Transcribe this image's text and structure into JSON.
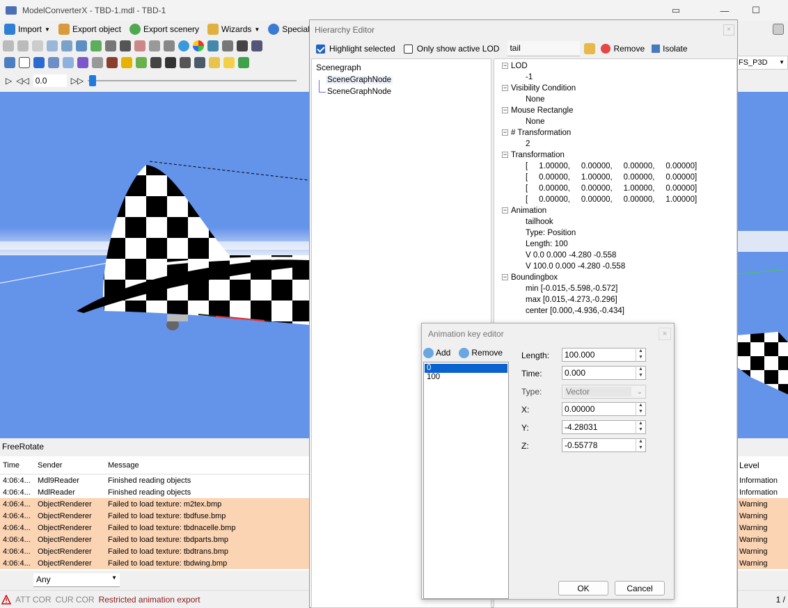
{
  "window": {
    "title": "ModelConverterX - TBD-1.mdl - TBD-1"
  },
  "toolbar1": {
    "import": "Import",
    "export_object": "Export object",
    "export_scenery": "Export scenery",
    "wizards": "Wizards",
    "special_tools": "Special too"
  },
  "animation_bar": {
    "time_value": "0.0"
  },
  "right_edge": {
    "sim_label": "FS_P3D"
  },
  "status_label": "FreeRotate",
  "log": {
    "headers": {
      "time": "Time",
      "sender": "Sender",
      "message": "Message",
      "level": "Level"
    },
    "rows": [
      {
        "time": "4:06:4...",
        "sender": "Mdl9Reader",
        "message": "Finished reading objects",
        "level": "Information",
        "warn": false
      },
      {
        "time": "4:06:4...",
        "sender": "MdlReader",
        "message": "Finished reading objects",
        "level": "Information",
        "warn": false
      },
      {
        "time": "4:06:4...",
        "sender": "ObjectRenderer",
        "message": "Failed to load texture: m2tex.bmp",
        "level": "Warning",
        "warn": true
      },
      {
        "time": "4:06:4...",
        "sender": "ObjectRenderer",
        "message": "Failed to load texture: tbdfuse.bmp",
        "level": "Warning",
        "warn": true
      },
      {
        "time": "4:06:4...",
        "sender": "ObjectRenderer",
        "message": "Failed to load texture: tbdnacelle.bmp",
        "level": "Warning",
        "warn": true
      },
      {
        "time": "4:06:4...",
        "sender": "ObjectRenderer",
        "message": "Failed to load texture: tbdparts.bmp",
        "level": "Warning",
        "warn": true
      },
      {
        "time": "4:06:4...",
        "sender": "ObjectRenderer",
        "message": "Failed to load texture: tbdtrans.bmp",
        "level": "Warning",
        "warn": true
      },
      {
        "time": "4:06:4...",
        "sender": "ObjectRenderer",
        "message": "Failed to load texture: tbdwing.bmp",
        "level": "Warning",
        "warn": true
      }
    ],
    "filter_value": "Any"
  },
  "statusbar": {
    "att": "ATT COR",
    "cur": "CUR COR",
    "message": "Restricted animation export",
    "page": "1 /"
  },
  "hierarchy": {
    "title": "Hierarchy Editor",
    "highlight_selected": "Highlight selected",
    "only_active_lod": "Only show active LOD",
    "search_value": "tail",
    "remove": "Remove",
    "isolate": "Isolate",
    "scenegraph_label": "Scenegraph",
    "nodes": [
      "SceneGraphNode",
      "SceneGraphNode"
    ],
    "props": {
      "lod": "LOD",
      "lod_val": "-1",
      "vis": "Visibility Condition",
      "vis_val": "None",
      "mouse": "Mouse Rectangle",
      "mouse_val": "None",
      "ntrans": "# Transformation",
      "ntrans_val": "2",
      "trans": "Transformation",
      "matrix": [
        "[     1.00000,     0.00000,     0.00000,     0.00000]",
        "[     0.00000,     1.00000,     0.00000,     0.00000]",
        "[     0.00000,     0.00000,     1.00000,     0.00000]",
        "[     0.00000,     0.00000,     0.00000,     1.00000]"
      ],
      "anim": "Animation",
      "anim_vals": [
        "tailhook",
        "Type: Position",
        "Length: 100",
        "V 0.0 0.000 -4.280 -0.558",
        "V 100.0 0.000 -4.280 -0.558"
      ],
      "bbox": "Boundingbox",
      "bbox_vals": [
        "min [-0.015,-5.598,-0.572]",
        "max [0.015,-4.273,-0.296]",
        "center [0.000,-4.936,-0.434]"
      ]
    }
  },
  "anim_editor": {
    "title": "Animation key editor",
    "add": "Add",
    "remove": "Remove",
    "keys": [
      "0",
      "100"
    ],
    "length_label": "Length:",
    "length_value": "100.000",
    "time_label": "Time:",
    "time_value": "0.000",
    "type_label": "Type:",
    "type_value": "Vector",
    "x_label": "X:",
    "x_value": "0.00000",
    "y_label": "Y:",
    "y_value": "-4.28031",
    "z_label": "Z:",
    "z_value": "-0.55778",
    "ok": "OK",
    "cancel": "Cancel"
  },
  "colors": {
    "sky": "#6493ea",
    "warning_row": "#fbd4b4",
    "selection": "#1f63c4"
  }
}
